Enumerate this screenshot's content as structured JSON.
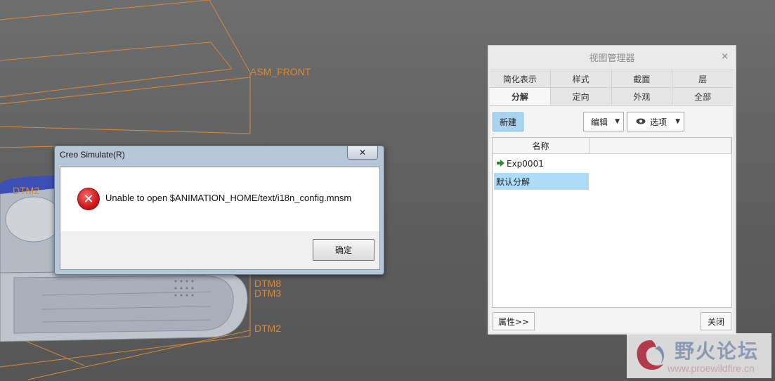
{
  "viewport": {
    "labels": [
      "ASM_FRONT",
      "DTM2",
      "DTM8",
      "DTM3",
      "DTM2"
    ],
    "line_color": "#d9893a",
    "background": "#646464"
  },
  "dialog": {
    "title": "Creo Simulate(R)",
    "close_label": "✕",
    "message": "Unable to open $ANIMATION_HOME/text/i18n_config.mnsm",
    "ok_label": "确定",
    "icon": "error-icon"
  },
  "view_manager": {
    "title": "视图管理器",
    "close_label": "×",
    "tabs_row1": [
      "简化表示",
      "样式",
      "截面",
      "层"
    ],
    "tabs_row2": [
      "分解",
      "定向",
      "外观",
      "全部"
    ],
    "active_tab": "分解",
    "new_label": "新建",
    "edit_label": "编辑",
    "options_label": "选项",
    "column_name": "名称",
    "rows": [
      "Exp0001",
      "默认分解"
    ],
    "selected_row": "默认分解",
    "properties_label": "属性>>",
    "close_button_label": "关闭",
    "accent": "#a8d4f2"
  },
  "watermark": {
    "title": "野火论坛",
    "url": "www.proewildfire.cn"
  }
}
